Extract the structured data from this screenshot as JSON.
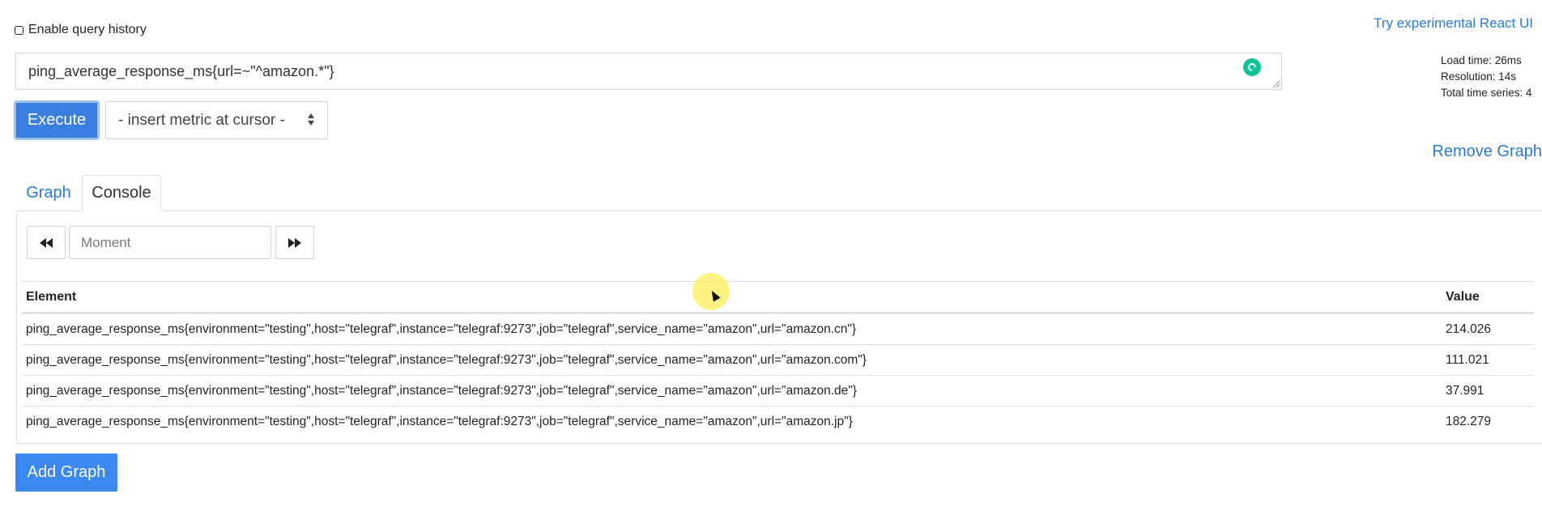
{
  "header": {
    "history_label": "Enable query history",
    "history_checked": false,
    "react_link": "Try experimental React UI"
  },
  "query": {
    "expression": "ping_average_response_ms{url=~\"^amazon.*\"}",
    "execute_label": "Execute",
    "metric_select": "- insert metric at cursor -"
  },
  "stats": {
    "load_time": "Load time: 26ms",
    "resolution": "Resolution: 14s",
    "total_series": "Total time series: 4"
  },
  "remove_graph": "Remove Graph",
  "tabs": [
    {
      "label": "Graph",
      "active": false
    },
    {
      "label": "Console",
      "active": true
    }
  ],
  "console": {
    "prev_icon": "fast-backward-icon",
    "next_icon": "fast-forward-icon",
    "moment_placeholder": "Moment"
  },
  "table": {
    "columns": [
      "Element",
      "Value"
    ],
    "rows": [
      {
        "element": "ping_average_response_ms{environment=\"testing\",host=\"telegraf\",instance=\"telegraf:9273\",job=\"telegraf\",service_name=\"amazon\",url=\"amazon.cn\"}",
        "value": "214.026"
      },
      {
        "element": "ping_average_response_ms{environment=\"testing\",host=\"telegraf\",instance=\"telegraf:9273\",job=\"telegraf\",service_name=\"amazon\",url=\"amazon.com\"}",
        "value": "111.021"
      },
      {
        "element": "ping_average_response_ms{environment=\"testing\",host=\"telegraf\",instance=\"telegraf:9273\",job=\"telegraf\",service_name=\"amazon\",url=\"amazon.de\"}",
        "value": "37.991"
      },
      {
        "element": "ping_average_response_ms{environment=\"testing\",host=\"telegraf\",instance=\"telegraf:9273\",job=\"telegraf\",service_name=\"amazon\",url=\"amazon.jp\"}",
        "value": "182.279"
      }
    ]
  },
  "add_graph": "Add Graph",
  "colors": {
    "link": "#2b7bd3",
    "primary": "#3a7fe0",
    "grammarly": "#15c39a"
  }
}
